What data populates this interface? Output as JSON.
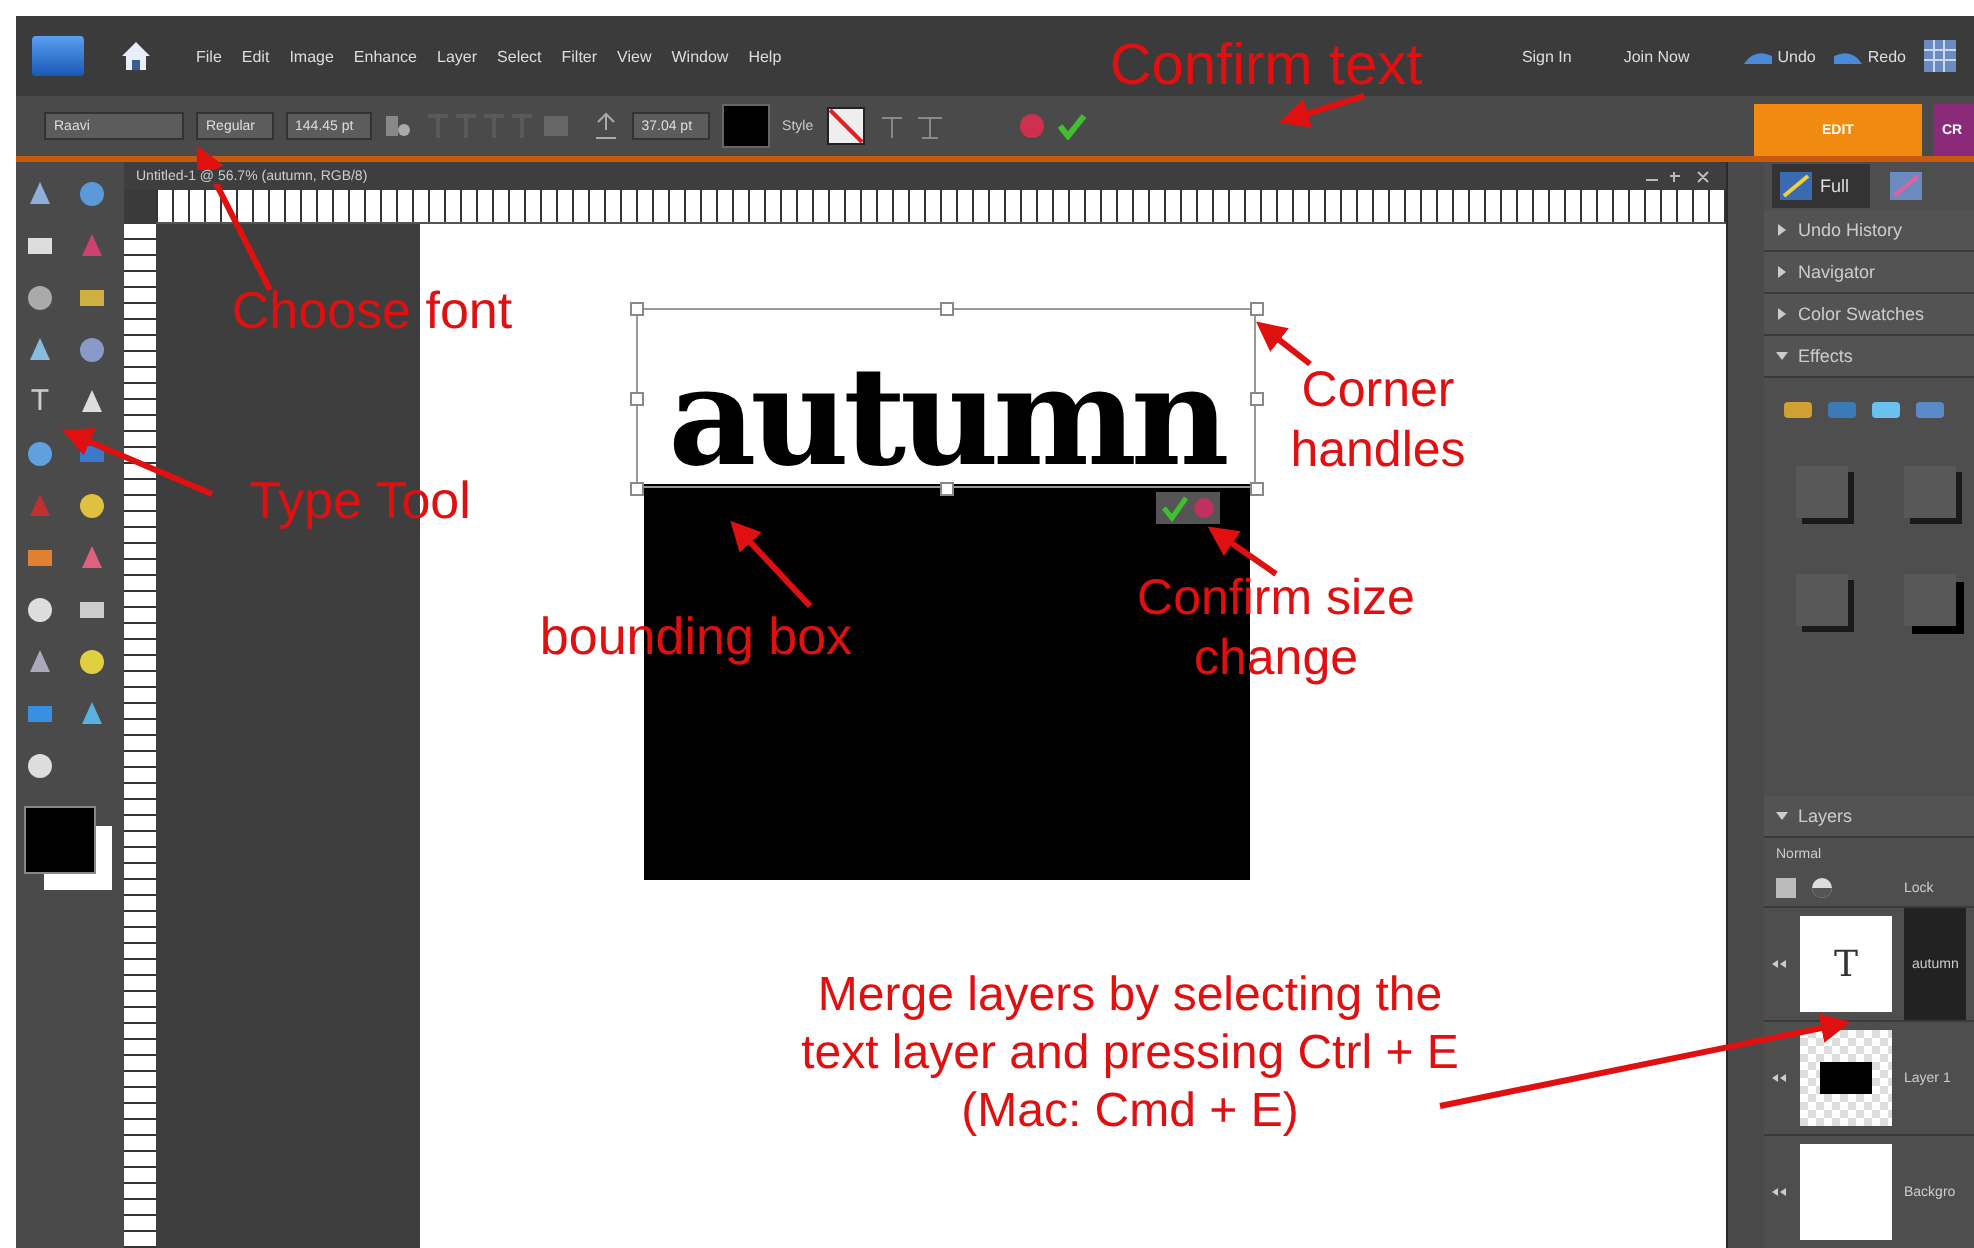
{
  "menu": [
    "File",
    "Edit",
    "Image",
    "Enhance",
    "Layer",
    "Select",
    "Filter",
    "View",
    "Window",
    "Help"
  ],
  "account_links": [
    "Sign In",
    "Join Now"
  ],
  "history_buttons": [
    {
      "label": "Undo"
    },
    {
      "label": "Redo"
    }
  ],
  "options_bar": {
    "font": "Raavi",
    "font_style": "Regular",
    "size": "144.45 pt",
    "leading": "37.04 pt",
    "style_label": "Style"
  },
  "mode_tabs": [
    {
      "label": "EDIT",
      "selected": true
    },
    {
      "label": "CR",
      "selected": false
    }
  ],
  "document": {
    "title": "Untitled-1 @ 56.7% (autumn, RGB/8)",
    "text": "autumn"
  },
  "type_tool_glyph": "T",
  "view_tab": {
    "label": "Full"
  },
  "panel_sections": [
    {
      "label": "Undo History",
      "expanded": false
    },
    {
      "label": "Navigator",
      "expanded": false
    },
    {
      "label": "Color Swatches",
      "expanded": false
    },
    {
      "label": "Effects",
      "expanded": true
    }
  ],
  "layers": {
    "title": "Layers",
    "blend_mode": "Normal",
    "lock_label": "Lock",
    "items": [
      {
        "name": "autumn",
        "kind": "text",
        "selected": true,
        "glyph": "T"
      },
      {
        "name": "Layer 1",
        "kind": "shape",
        "selected": false
      },
      {
        "name": "Backgro",
        "kind": "fill",
        "selected": false
      }
    ]
  },
  "annotations": [
    {
      "text": "Confirm text"
    },
    {
      "text": "Choose font"
    },
    {
      "text": "Corner handles"
    },
    {
      "text": "Type Tool"
    },
    {
      "text": "bounding box"
    },
    {
      "text": "Confirm size change"
    },
    {
      "text": "Merge layers by selecting the text layer and pressing Ctrl + E (Mac: Cmd + E)"
    }
  ]
}
